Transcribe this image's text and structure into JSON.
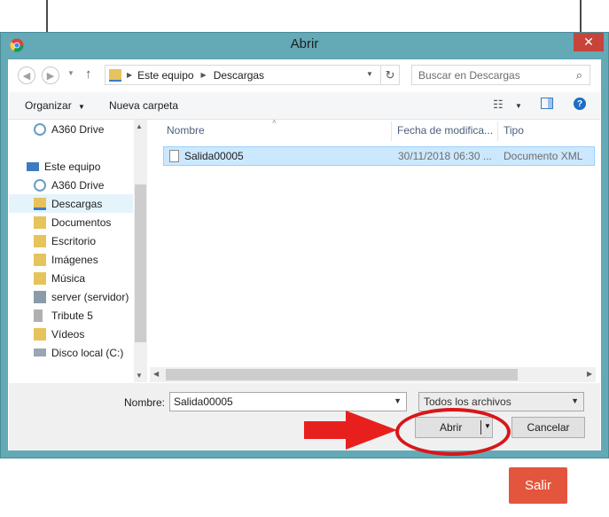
{
  "dialog": {
    "title": "Abrir",
    "close_label": "✕"
  },
  "address": {
    "crumbs": [
      "Este equipo",
      "Descargas"
    ],
    "search_placeholder": "Buscar en Descargas"
  },
  "toolbar": {
    "organize": "Organizar",
    "new_folder": "Nueva carpeta"
  },
  "nav": {
    "items": [
      {
        "label": "A360 Drive",
        "icon": "cloud-drive-icon"
      },
      {
        "label": "Este equipo",
        "icon": "computer-icon"
      },
      {
        "label": "A360 Drive",
        "icon": "cloud-drive-icon"
      },
      {
        "label": "Descargas",
        "icon": "downloads-folder-icon"
      },
      {
        "label": "Documentos",
        "icon": "documents-folder-icon"
      },
      {
        "label": "Escritorio",
        "icon": "desktop-folder-icon"
      },
      {
        "label": "Imágenes",
        "icon": "pictures-folder-icon"
      },
      {
        "label": "Música",
        "icon": "music-folder-icon"
      },
      {
        "label": "server (servidor)",
        "icon": "network-drive-icon"
      },
      {
        "label": "Tribute 5",
        "icon": "device-icon"
      },
      {
        "label": "Vídeos",
        "icon": "videos-folder-icon"
      },
      {
        "label": "Disco local (C:)",
        "icon": "local-disk-icon"
      }
    ]
  },
  "list": {
    "columns": [
      "Nombre",
      "Fecha de modifica...",
      "Tipo"
    ],
    "rows": [
      {
        "name": "Salida00005",
        "date": "30/11/2018 06:30 ...",
        "type": "Documento XML"
      }
    ]
  },
  "bottom": {
    "name_label": "Nombre:",
    "name_value": "Salida00005",
    "filetype_value": "Todos los archivos",
    "open_label": "Abrir",
    "cancel_label": "Cancelar"
  },
  "app": {
    "exit_label": "Salir",
    "exit_color": "#e4553d"
  },
  "colors": {
    "frame": "#63a9b6",
    "close": "#c7443b",
    "selection": "#cce8ff",
    "annotation": "#e8201d"
  }
}
